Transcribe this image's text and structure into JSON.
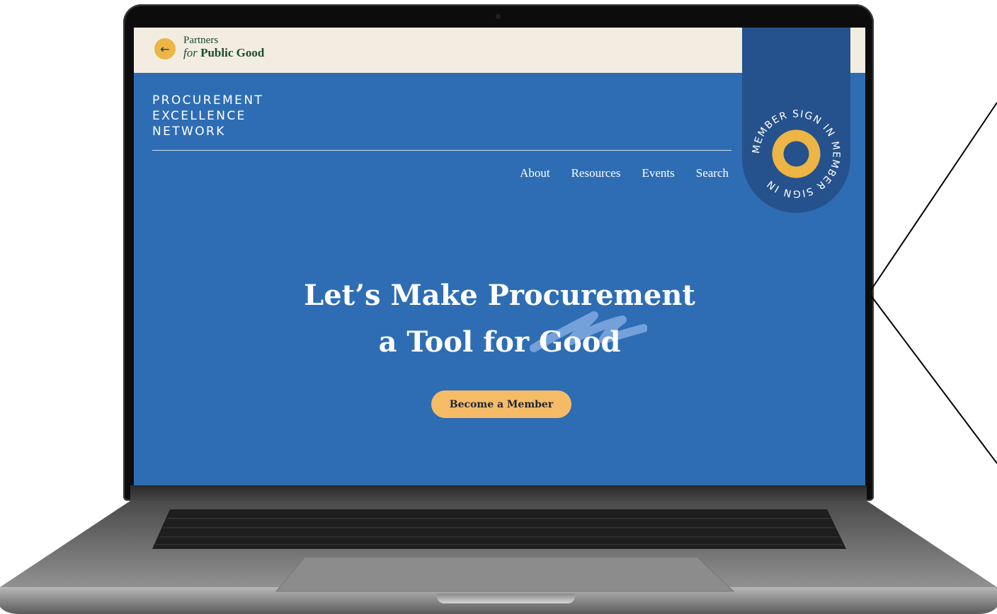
{
  "header": {
    "back_icon": "←",
    "logo_line1": "Partners",
    "logo_line2_italic": "for",
    "logo_line2_bold": "Public Good"
  },
  "network_title": [
    "PROCUREMENT",
    "EXCELLENCE",
    "NETWORK"
  ],
  "nav": {
    "items": [
      "About",
      "Resources",
      "Events",
      "Search"
    ]
  },
  "member_badge": {
    "ring_text": "MEMBER SIGN IN MEMBER SIGN IN"
  },
  "hero": {
    "line1": "Let’s Make Procurement",
    "line2": "a Tool for Good"
  },
  "cta": {
    "label": "Become a Member"
  },
  "colors": {
    "page_blue": "#2e6db4",
    "topbar_cream": "#f3ede1",
    "badge_navy": "#25528c",
    "accent_yellow": "#ecb545",
    "button_yellow": "#f5bb66",
    "logo_green": "#1b4a33"
  }
}
